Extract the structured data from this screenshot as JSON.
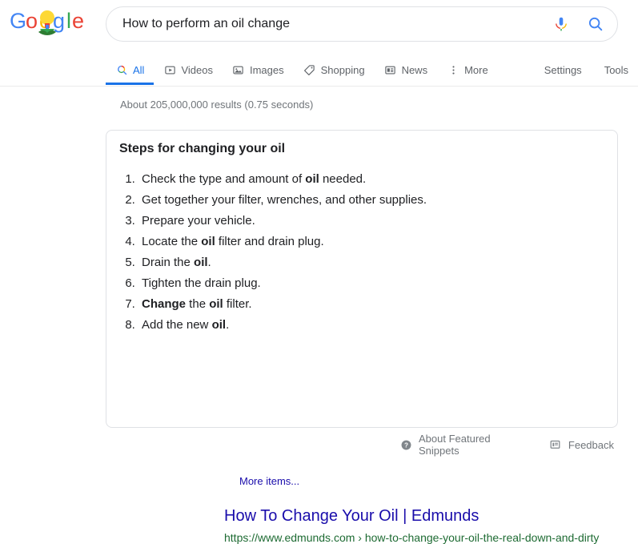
{
  "brand": {
    "logo_name": "google-doodle-logo",
    "logo_letters": [
      "G",
      "o",
      "o",
      "g",
      "l",
      "e"
    ],
    "colors": {
      "blue": "#4285F4",
      "red": "#EA4335",
      "yellow": "#FBBC05",
      "green": "#34A853",
      "link": "#1a0dab",
      "url_green": "#1e6b33",
      "accent": "#1a73e8",
      "muted": "#70757a"
    }
  },
  "search": {
    "value": "How to perform an oil change",
    "placeholder": "Search",
    "mic_icon": "microphone-icon",
    "search_icon": "search-icon"
  },
  "nav": {
    "tabs": [
      {
        "label": "All",
        "icon": "search-icon",
        "active": true
      },
      {
        "label": "Videos",
        "icon": "video-icon",
        "active": false
      },
      {
        "label": "Images",
        "icon": "image-icon",
        "active": false
      },
      {
        "label": "Shopping",
        "icon": "tag-icon",
        "active": false
      },
      {
        "label": "News",
        "icon": "newspaper-icon",
        "active": false
      },
      {
        "label": "More",
        "icon": "more-vertical-icon",
        "active": false
      }
    ],
    "right": [
      {
        "label": "Settings"
      },
      {
        "label": "Tools"
      }
    ]
  },
  "results": {
    "count_text": "About 205,000,000 results (0.75 seconds)"
  },
  "featured_snippet": {
    "title": "Steps for changing your oil",
    "steps": [
      [
        {
          "t": "Check the type and amount of ",
          "b": false
        },
        {
          "t": "oil",
          "b": true
        },
        {
          "t": " needed.",
          "b": false
        }
      ],
      [
        {
          "t": "Get together your filter, wrenches, and other supplies.",
          "b": false
        }
      ],
      [
        {
          "t": "Prepare your vehicle.",
          "b": false
        }
      ],
      [
        {
          "t": "Locate the ",
          "b": false
        },
        {
          "t": "oil",
          "b": true
        },
        {
          "t": " filter and drain plug.",
          "b": false
        }
      ],
      [
        {
          "t": "Drain the ",
          "b": false
        },
        {
          "t": "oil",
          "b": true
        },
        {
          "t": ".",
          "b": false
        }
      ],
      [
        {
          "t": "Tighten the drain plug.",
          "b": false
        }
      ],
      [
        {
          "t": "Change",
          "b": true
        },
        {
          "t": " the ",
          "b": false
        },
        {
          "t": "oil",
          "b": true
        },
        {
          "t": " filter.",
          "b": false
        }
      ],
      [
        {
          "t": "Add the new ",
          "b": false
        },
        {
          "t": "oil",
          "b": true
        },
        {
          "t": ".",
          "b": false
        }
      ]
    ],
    "more_items_label": "More items...",
    "source_title": "How To Change Your Oil | Edmunds",
    "source_url": "https://www.edmunds.com › how-to-change-your-oil-the-real-down-and-dirty"
  },
  "footer": {
    "about_label": "About Featured Snippets",
    "about_icon": "help-circle-icon",
    "feedback_label": "Feedback",
    "feedback_icon": "flag-icon"
  }
}
